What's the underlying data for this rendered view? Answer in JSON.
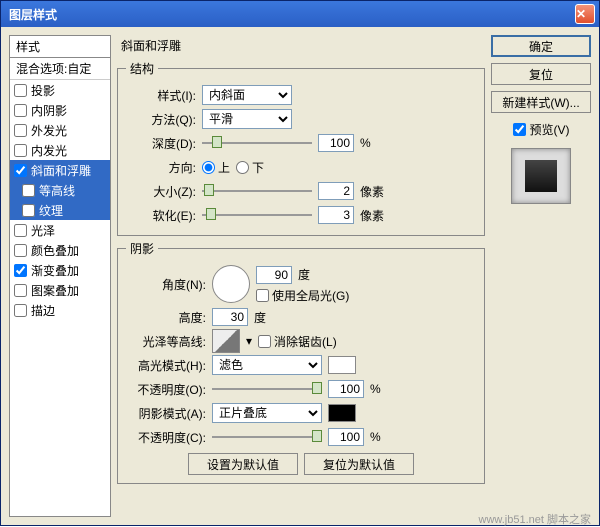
{
  "title": "图层样式",
  "sidebar": {
    "header": "样式",
    "blend": "混合选项:自定",
    "items": [
      {
        "label": "投影",
        "checked": false
      },
      {
        "label": "内阴影",
        "checked": false
      },
      {
        "label": "外发光",
        "checked": false
      },
      {
        "label": "内发光",
        "checked": false
      },
      {
        "label": "斜面和浮雕",
        "checked": true
      },
      {
        "label": "等高线",
        "checked": false,
        "sub": true
      },
      {
        "label": "纹理",
        "checked": false,
        "sub": true
      },
      {
        "label": "光泽",
        "checked": false
      },
      {
        "label": "颜色叠加",
        "checked": false
      },
      {
        "label": "渐变叠加",
        "checked": true
      },
      {
        "label": "图案叠加",
        "checked": false
      },
      {
        "label": "描边",
        "checked": false
      }
    ]
  },
  "bevel": {
    "title": "斜面和浮雕",
    "structureLegend": "结构",
    "styleLabel": "样式(I):",
    "styleVal": "内斜面",
    "techLabel": "方法(Q):",
    "techVal": "平滑",
    "depthLabel": "深度(D):",
    "depthVal": "100",
    "depthUnit": "%",
    "dirLabel": "方向:",
    "dirUp": "上",
    "dirDown": "下",
    "sizeLabel": "大小(Z):",
    "sizeVal": "2",
    "sizeUnit": "像素",
    "softLabel": "软化(E):",
    "softVal": "3",
    "softUnit": "像素",
    "shadingLegend": "阴影",
    "angleLabel": "角度(N):",
    "angleVal": "90",
    "angleUnit": "度",
    "globalLabel": "使用全局光(G)",
    "altLabel": "高度:",
    "altVal": "30",
    "altUnit": "度",
    "glossLabel": "光泽等高线:",
    "aaLabel": "消除锯齿(L)",
    "hiLabel": "高光模式(H):",
    "hiVal": "滤色",
    "hiColor": "#ffffff",
    "hiOpLabel": "不透明度(O):",
    "hiOpVal": "100",
    "shLabel": "阴影模式(A):",
    "shVal": "正片叠底",
    "shColor": "#000000",
    "shOpLabel": "不透明度(C):",
    "shOpVal": "100",
    "btnDefault": "设置为默认值",
    "btnReset": "复位为默认值"
  },
  "buttons": {
    "ok": "确定",
    "cancel": "复位",
    "newStyle": "新建样式(W)...",
    "preview": "预览(V)"
  },
  "watermark": "www.jb51.net 脚本之家"
}
